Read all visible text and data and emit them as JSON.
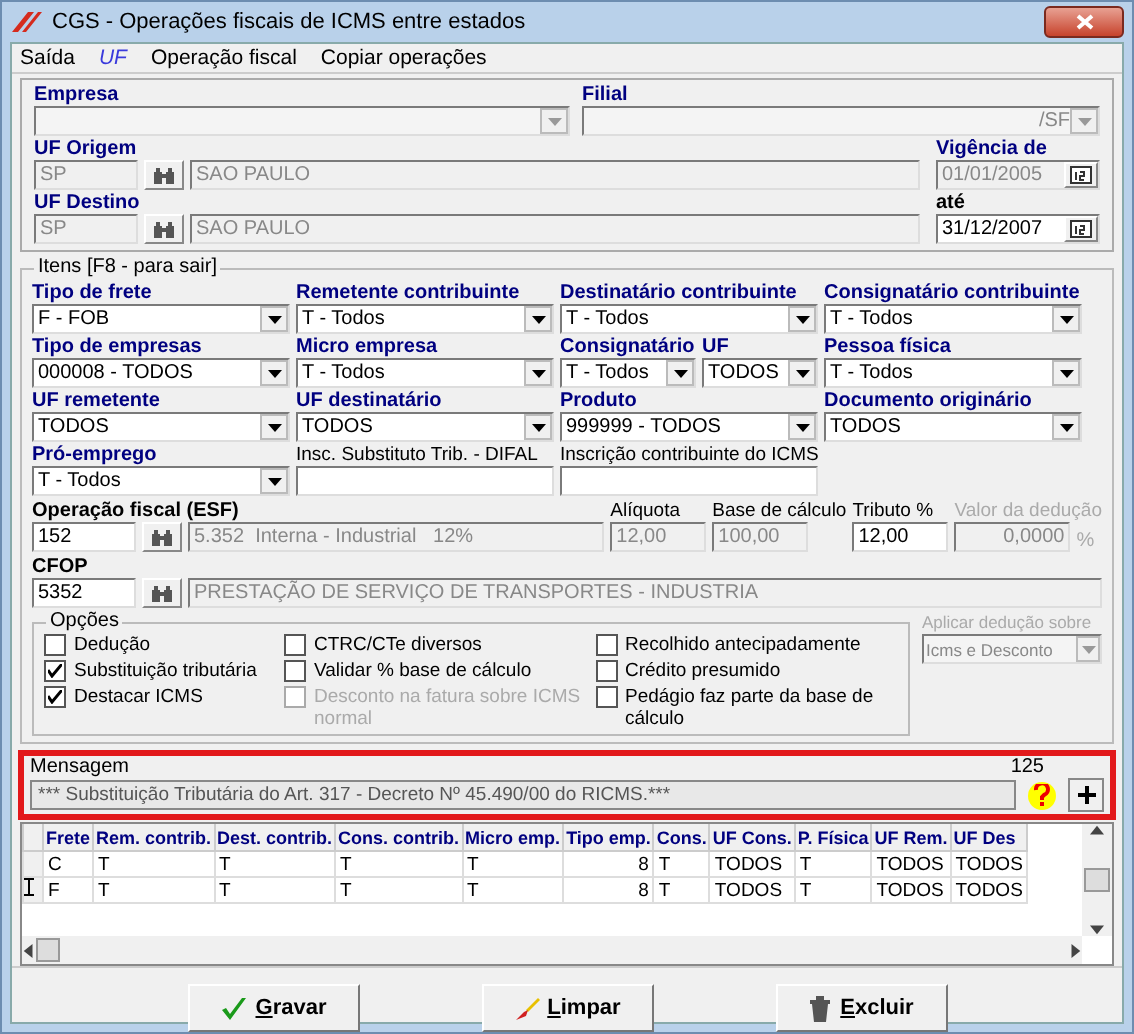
{
  "window": {
    "title": "CGS - Operações fiscais de ICMS entre estados"
  },
  "menu": [
    {
      "label": "Saída",
      "kind": "plain"
    },
    {
      "label": "UF",
      "kind": "italic"
    },
    {
      "label": "Operação fiscal",
      "kind": "plain"
    },
    {
      "label": "Copiar operações",
      "kind": "plain"
    }
  ],
  "header": {
    "empresa": {
      "label": "Empresa"
    },
    "filial": {
      "label": "Filial",
      "value": "/SF"
    },
    "uf_origem": {
      "label": "UF Origem",
      "code": "SP",
      "name": "SAO PAULO"
    },
    "vigencia_de": {
      "label": "Vigência de",
      "value": "01/01/2005",
      "disabled": true
    },
    "uf_destino": {
      "label": "UF Destino",
      "code": "SP",
      "name": "SAO PAULO"
    },
    "ate": {
      "label": "até",
      "value": "31/12/2007",
      "disabled": false
    }
  },
  "itens": {
    "title": "Itens [F8 - para sair]",
    "fields": [
      {
        "label": "Tipo de frete",
        "value": "F - FOB",
        "kind": "combo",
        "bold": true
      },
      {
        "label": "Remetente contribuinte",
        "value": "T - Todos",
        "kind": "combo",
        "bold": true
      },
      {
        "label": "Destinatário contribuinte",
        "value": "T - Todos",
        "kind": "combo",
        "bold": true
      },
      {
        "label": "Consignatário contribuinte",
        "value": "T - Todos",
        "kind": "combo",
        "bold": true
      },
      {
        "label": "Tipo de empresas",
        "value": "000008 - TODOS",
        "kind": "combo",
        "bold": true
      },
      {
        "label": "Micro empresa",
        "value": "T - Todos",
        "kind": "combo",
        "bold": true
      },
      {
        "label": "Consignatário",
        "value": "T - Todos",
        "kind": "combo",
        "bold": true
      },
      {
        "label": "UF",
        "value": "TODOS",
        "kind": "combo",
        "bold": true
      },
      {
        "label": "Pessoa física",
        "value": "T - Todos",
        "kind": "combo",
        "bold": true
      },
      {
        "label": "UF remetente",
        "value": "TODOS",
        "kind": "combo",
        "bold": true
      },
      {
        "label": "UF destinatário",
        "value": "TODOS",
        "kind": "combo",
        "bold": true
      },
      {
        "label": "Produto",
        "value": "999999 - TODOS",
        "kind": "combo",
        "bold": true
      },
      {
        "label": "Documento originário",
        "value": "TODOS",
        "kind": "combo",
        "bold": true
      },
      {
        "label": "Pró-emprego",
        "value": "T - Todos",
        "kind": "combo",
        "bold": true
      },
      {
        "label": "Insc. Substituto Trib. - DIFAL",
        "kind": "text",
        "bold": false
      },
      {
        "label": "Inscrição contribuinte do ICMS",
        "kind": "text",
        "bold": false
      }
    ],
    "operacao": {
      "label": "Operação fiscal (ESF)",
      "code": "152",
      "description": "5.352  Interna - Industrial   12%"
    },
    "values": [
      {
        "label": "Alíquota",
        "value": "12,00",
        "disabled": true
      },
      {
        "label": "Base de cálculo",
        "value": "100,00",
        "disabled": true
      },
      {
        "label": "Tributo %",
        "value": "12,00",
        "disabled": false
      },
      {
        "label": "Valor da dedução",
        "value": "0,0000",
        "disabled": true,
        "suffix": "%"
      }
    ],
    "cfop": {
      "label": "CFOP",
      "code": "5352",
      "description": "PRESTAÇÃO DE SERVIÇO DE TRANSPORTES - INDUSTRIA"
    },
    "opcoes": {
      "title": "Opções",
      "columns": [
        [
          {
            "label": "Dedução",
            "checked": false,
            "disabled": false
          },
          {
            "label": "Substituição tributária",
            "checked": true,
            "disabled": false
          },
          {
            "label": "Destacar ICMS",
            "checked": true,
            "disabled": false
          }
        ],
        [
          {
            "label": "CTRC/CTe diversos",
            "checked": false,
            "disabled": false
          },
          {
            "label": "Validar % base de cálculo",
            "checked": false,
            "disabled": false
          },
          {
            "label": "Desconto na fatura sobre ICMS normal",
            "checked": false,
            "disabled": true
          }
        ],
        [
          {
            "label": "Recolhido antecipadamente",
            "checked": false,
            "disabled": false
          },
          {
            "label": "Crédito presumido",
            "checked": false,
            "disabled": false
          },
          {
            "label": "Pedágio faz parte da base de cálculo",
            "checked": false,
            "disabled": false
          }
        ]
      ]
    },
    "deducao": {
      "label": "Aplicar dedução sobre",
      "value": "Icms e Desconto",
      "disabled": true
    }
  },
  "mensagem": {
    "label": "Mensagem",
    "count": "125",
    "text": "*** Substituição Tributária do Art. 317 - Decreto Nº 45.490/00 do RICMS.***",
    "highlighted": true
  },
  "table": {
    "columns": [
      "Frete",
      "Rem. contrib.",
      "Dest. contrib.",
      "Cons. contrib.",
      "Micro emp.",
      "Tipo emp.",
      "Cons.",
      "UF Cons.",
      "P. Física",
      "UF Rem.",
      "UF Des"
    ],
    "rows": [
      {
        "current": false,
        "cells": [
          "C",
          "T",
          "T",
          "T",
          "T",
          "8",
          "T",
          "TODOS",
          "T",
          "TODOS",
          "TODOS"
        ]
      },
      {
        "current": true,
        "cells": [
          "F",
          "T",
          "T",
          "T",
          "T",
          "8",
          "T",
          "TODOS",
          "T",
          "TODOS",
          "TODOS"
        ]
      }
    ]
  },
  "buttons": [
    {
      "label": "Gravar",
      "kind": "check"
    },
    {
      "label": "Limpar",
      "kind": "brush"
    },
    {
      "label": "Excluir",
      "kind": "trash"
    }
  ]
}
